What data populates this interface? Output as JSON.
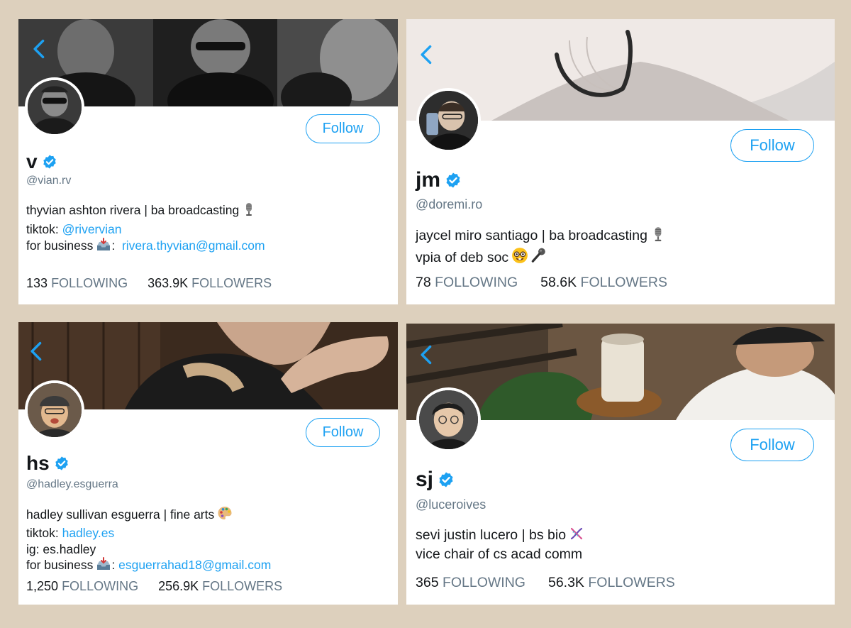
{
  "colors": {
    "background": "#ddd0bd",
    "accent": "#1da1f2",
    "muted": "#657786"
  },
  "profiles": [
    {
      "name": "v",
      "handle": "@vian.rv",
      "follow_label": "Follow",
      "bio": {
        "line1": "thyvian ashton rivera | ba broadcasting",
        "tiktok_label": "tiktok:",
        "tiktok_link": "@rivervian",
        "business_label": "for business",
        "business_sep": ":",
        "email": "rivera.thyvian@gmail.com"
      },
      "following_count": "133",
      "following_label": "FOLLOWING",
      "followers_count": "363.9K",
      "followers_label": "FOLLOWERS",
      "icons": [
        "back-icon",
        "verified-icon",
        "microphone-icon",
        "inbox-tray-icon"
      ]
    },
    {
      "name": "jm",
      "handle": "@doremi.ro",
      "follow_label": "Follow",
      "bio": {
        "line1": "jaycel miro santiago | ba broadcasting",
        "line2": "vpia of deb soc"
      },
      "following_count": "78",
      "following_label": "FOLLOWING",
      "followers_count": "58.6K",
      "followers_label": "FOLLOWERS",
      "icons": [
        "back-icon",
        "verified-icon",
        "microphone-icon",
        "nerd-face-icon",
        "mic-icon"
      ]
    },
    {
      "name": "hs",
      "handle": "@hadley.esguerra",
      "follow_label": "Follow",
      "bio": {
        "line1": "hadley sullivan esguerra | fine arts",
        "tiktok_label": "tiktok:",
        "tiktok_link": "hadley.es",
        "ig_line": "ig: es.hadley",
        "business_label": "for business",
        "business_sep": ":",
        "email": "esguerrahad18@gmail.com"
      },
      "following_count": "1,250",
      "following_label": "FOLLOWING",
      "followers_count": "256.9K",
      "followers_label": "FOLLOWERS",
      "icons": [
        "back-icon",
        "verified-icon",
        "palette-icon",
        "inbox-tray-icon"
      ]
    },
    {
      "name": "sj",
      "handle": "@luceroives",
      "follow_label": "Follow",
      "bio": {
        "line1": "sevi justin lucero | bs bio",
        "line2": "vice chair of cs acad comm"
      },
      "following_count": "365",
      "following_label": "FOLLOWING",
      "followers_count": "56.3K",
      "followers_label": "FOLLOWERS",
      "icons": [
        "back-icon",
        "verified-icon",
        "dna-icon"
      ]
    }
  ]
}
